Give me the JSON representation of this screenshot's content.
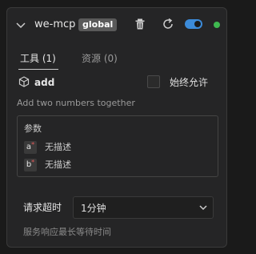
{
  "server": {
    "name": "we-mcp",
    "badge": "global",
    "enabled": true,
    "status_color": "#3fb950"
  },
  "tabs": [
    {
      "label": "工具 (1)",
      "active": true
    },
    {
      "label": "资源 (0)",
      "active": false
    }
  ],
  "tool": {
    "icon": "cube-icon",
    "name": "add",
    "always_allow_label": "始终允许",
    "always_allow_checked": false,
    "description": "Add two numbers together",
    "params_title": "参数",
    "params": [
      {
        "name": "a",
        "required": true,
        "description": "无描述"
      },
      {
        "name": "b",
        "required": true,
        "description": "无描述"
      }
    ]
  },
  "timeout": {
    "label": "请求超时",
    "value": "1分钟",
    "hint": "服务响应最长等待时间"
  },
  "colors": {
    "accent": "#3c8bd9",
    "required": "#e55a5a",
    "background": "#252526"
  }
}
